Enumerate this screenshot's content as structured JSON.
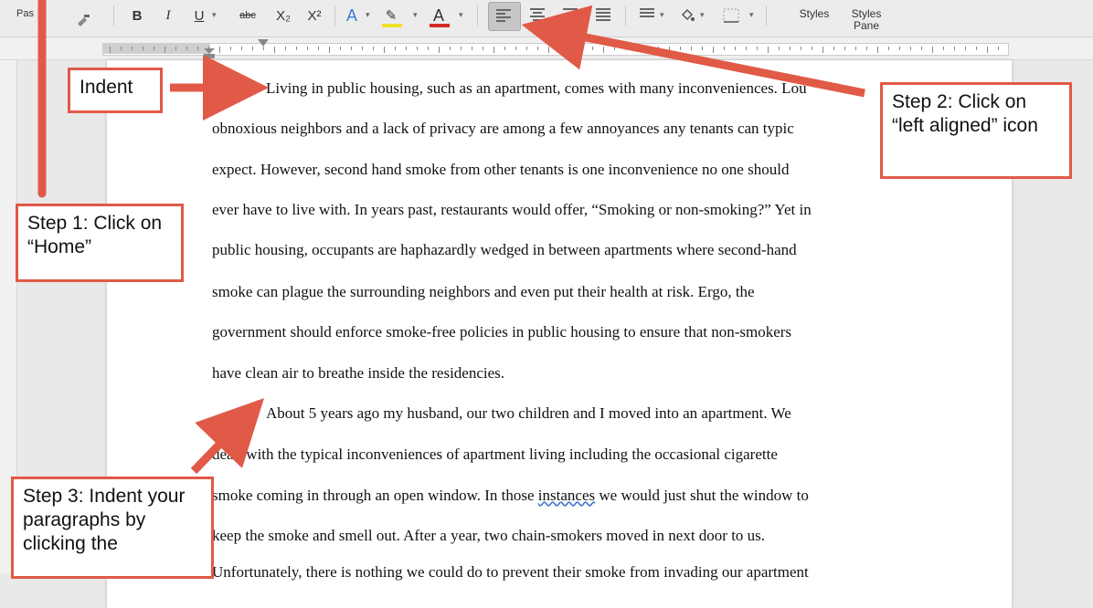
{
  "toolbar": {
    "paste_label": "Pas",
    "bold": "B",
    "italic": "I",
    "underline": "U",
    "strikethrough": "abc",
    "subscript": "X₂",
    "superscript": "X²",
    "text_effects": "A",
    "highlight": "✎",
    "font_color": "A",
    "styles_label": "Styles",
    "styles_pane_label": "Styles\nPane",
    "colors": {
      "highlight": "#f2e12b",
      "font_color": "#d62a2a",
      "active_align": "#c6c6c6"
    }
  },
  "document": {
    "lines": [
      "Living in public housing, such as an apartment, comes with many inconveniences. Lou",
      "obnoxious neighbors and a lack of privacy are among a few annoyances any tenants can typic",
      "expect. However, second hand smoke from other tenants is one inconvenience no one should",
      "ever have to live with. In years past, restaurants would offer, “Smoking or non-smoking?” Yet in",
      "public housing, occupants are haphazardly wedged in between apartments where second-hand",
      "smoke can plague the surrounding neighbors and even put their health at risk. Ergo, the",
      "government should enforce smoke-free policies in public housing to ensure that non-smokers",
      "have clean air to breathe inside the residencies.",
      "About 5 years ago my husband, our two children and I moved into an apartment. We",
      "dealt with the typical inconveniences of apartment living including the occasional cigarette",
      "smoke coming in through an open window. In those",
      "instances",
      "we would just shut the window to",
      "keep the smoke and smell out. After a year, two chain-smokers moved in next door to us.",
      "Unfortunately, there is nothing we could do to prevent their smoke from invading our apartment"
    ]
  },
  "callouts": {
    "indent": "Indent",
    "step1": "Step 1: Click on “Home”",
    "step2": "Step 2: Click on “left aligned” icon",
    "step3": "Step 3: Indent your paragraphs by clicking the"
  },
  "annotation_color": "#e05a47"
}
